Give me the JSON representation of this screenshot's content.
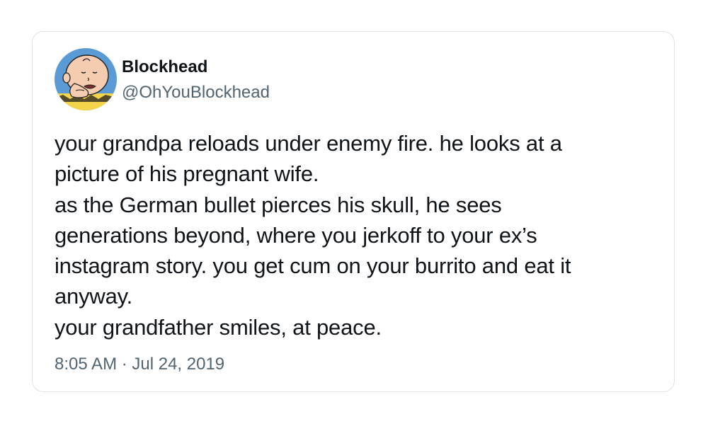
{
  "tweet": {
    "author": {
      "display_name": "Blockhead",
      "handle": "@OhYouBlockhead",
      "avatar_icon": "charlie-brown-avatar-icon"
    },
    "text_lines": [
      "your grandpa reloads under enemy fire. he looks at a",
      "picture of his pregnant wife.",
      "as the German bullet pierces his skull, he sees",
      "generations beyond, where you jerkoff to your ex’s",
      "instagram story. you get cum on your burrito and eat it",
      "anyway.",
      "your grandfather smiles, at peace."
    ],
    "timestamp": "8:05 AM · Jul 24, 2019"
  },
  "colors": {
    "text_primary": "#0f1419",
    "text_secondary": "#536471",
    "card_border": "#dfe3e8",
    "avatar_background": "#5b9bd5"
  }
}
